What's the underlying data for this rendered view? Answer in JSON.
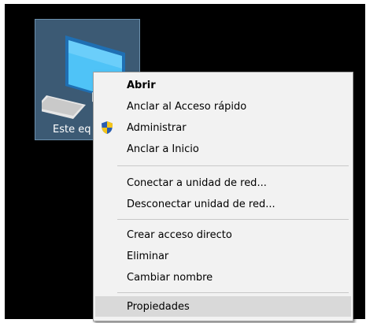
{
  "desktop": {
    "icon_label": "Este eq",
    "icon_name": "computer-icon"
  },
  "context_menu": {
    "items": [
      {
        "label": "Abrir",
        "bold": true
      },
      {
        "label": "Anclar al Acceso rápido"
      },
      {
        "label": "Administrar",
        "icon": "uac-shield-icon"
      },
      {
        "label": "Anclar a Inicio"
      },
      {
        "label": "Conectar a unidad de red..."
      },
      {
        "label": "Desconectar unidad de red..."
      },
      {
        "label": "Crear acceso directo"
      },
      {
        "label": "Eliminar"
      },
      {
        "label": "Cambiar nombre"
      },
      {
        "label": "Propiedades",
        "highlighted": true
      }
    ]
  },
  "colors": {
    "background": "#000000",
    "menu_background": "#f2f2f2",
    "highlight": "#d9d9d9",
    "icon_selection": "#3c5a74"
  }
}
